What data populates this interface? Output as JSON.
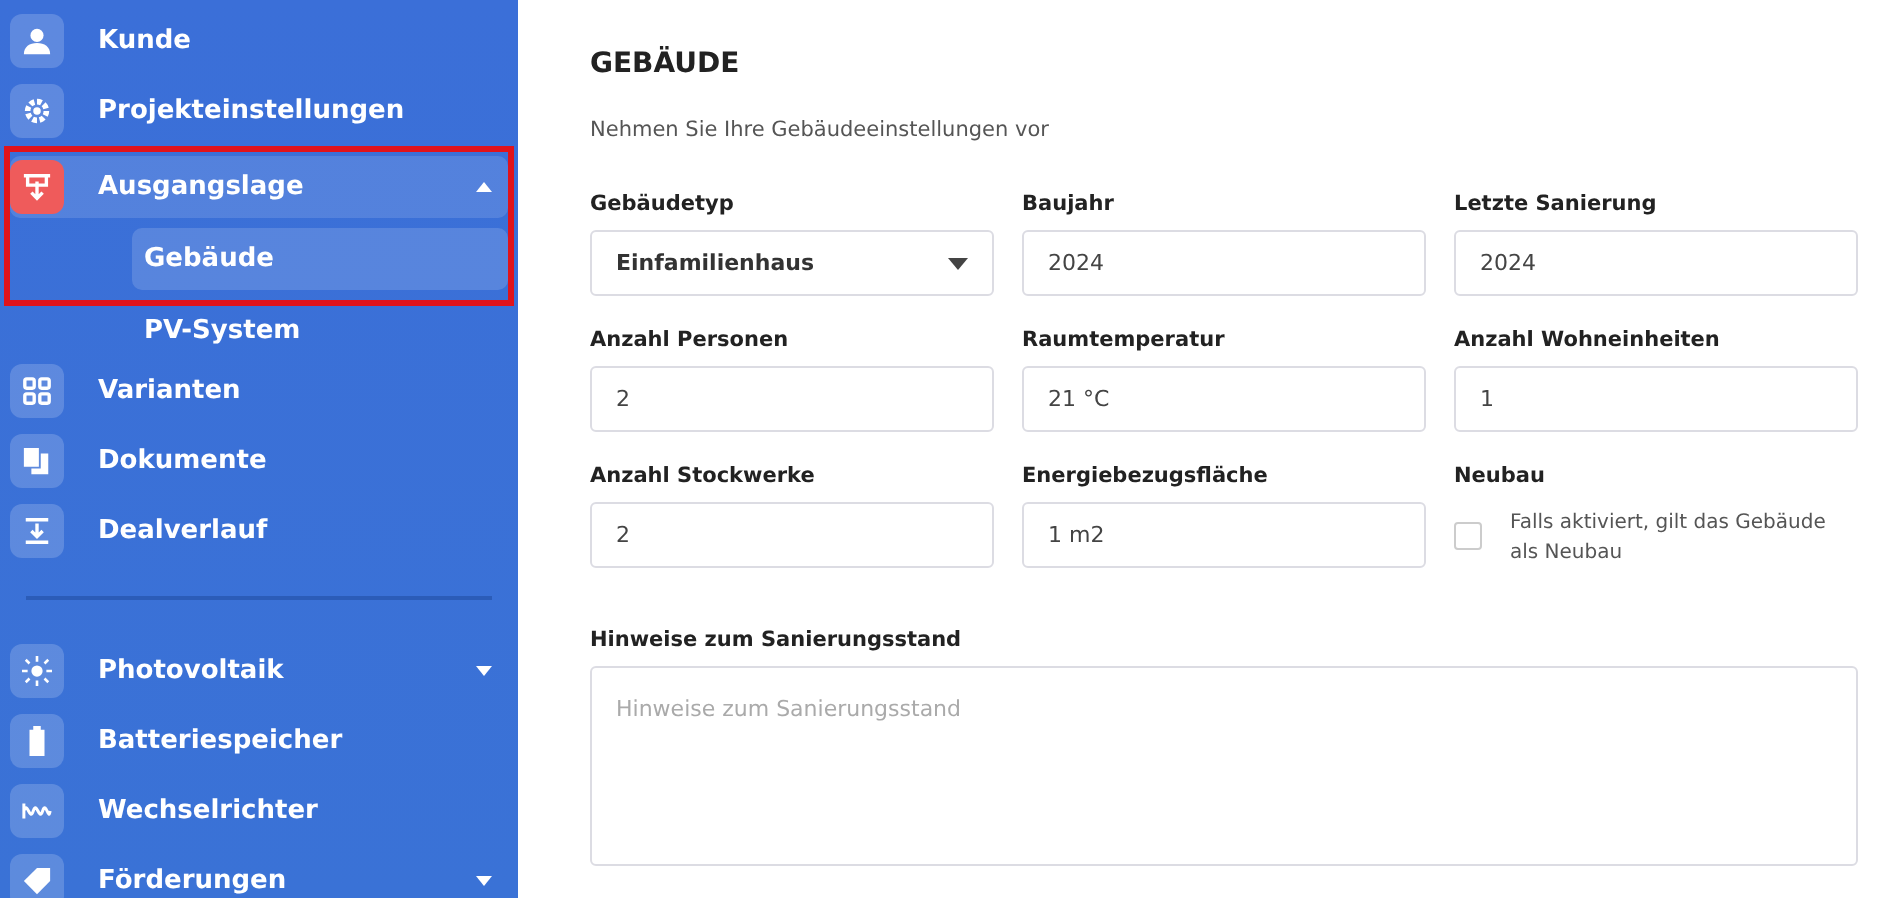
{
  "sidebar": {
    "top_items": [
      {
        "label": "Kunde",
        "selected": false
      },
      {
        "label": "Projekteinstellungen",
        "selected": false
      },
      {
        "label": "Ausgangslage",
        "selected": true,
        "expanded": true,
        "highlighted": true,
        "children": [
          {
            "label": "Gebäude",
            "selected": true
          },
          {
            "label": "PV-System",
            "selected": false
          }
        ]
      },
      {
        "label": "Varianten",
        "selected": false
      },
      {
        "label": "Dokumente",
        "selected": false
      },
      {
        "label": "Dealverlauf",
        "selected": false
      }
    ],
    "bottom_items": [
      {
        "label": "Photovoltaik",
        "selected": false,
        "expanded": false
      },
      {
        "label": "Batteriespeicher",
        "selected": false
      },
      {
        "label": "Wechselrichter",
        "selected": false
      },
      {
        "label": "Förderungen",
        "selected": false,
        "expanded": false
      }
    ]
  },
  "main": {
    "title": "GEBÄUDE",
    "subtitle": "Nehmen Sie Ihre Gebäudeeinstellungen vor",
    "fields": [
      {
        "kind": "select",
        "label": "Gebäudetyp",
        "value": "Einfamilienhaus"
      },
      {
        "kind": "input",
        "label": "Baujahr",
        "value": "2024"
      },
      {
        "kind": "input",
        "label": "Letzte Sanierung",
        "value": "2024"
      },
      {
        "kind": "input",
        "label": "Anzahl Personen",
        "value": "2"
      },
      {
        "kind": "input",
        "label": "Raumtemperatur",
        "value": "21 °C"
      },
      {
        "kind": "input",
        "label": "Anzahl Wohneinheiten",
        "value": "1"
      },
      {
        "kind": "input",
        "label": "Anzahl Stockwerke",
        "value": "2"
      },
      {
        "kind": "input",
        "label": "Energiebezugsfläche",
        "value": "1 m2"
      },
      {
        "kind": "checkbox",
        "label": "Neubau",
        "checked": false,
        "description": "Falls aktiviert, gilt das Gebäude als Neubau"
      }
    ],
    "notes": {
      "label": "Hinweise zum Sanierungsstand",
      "placeholder": "Hinweise zum Sanierungsstand"
    }
  }
}
